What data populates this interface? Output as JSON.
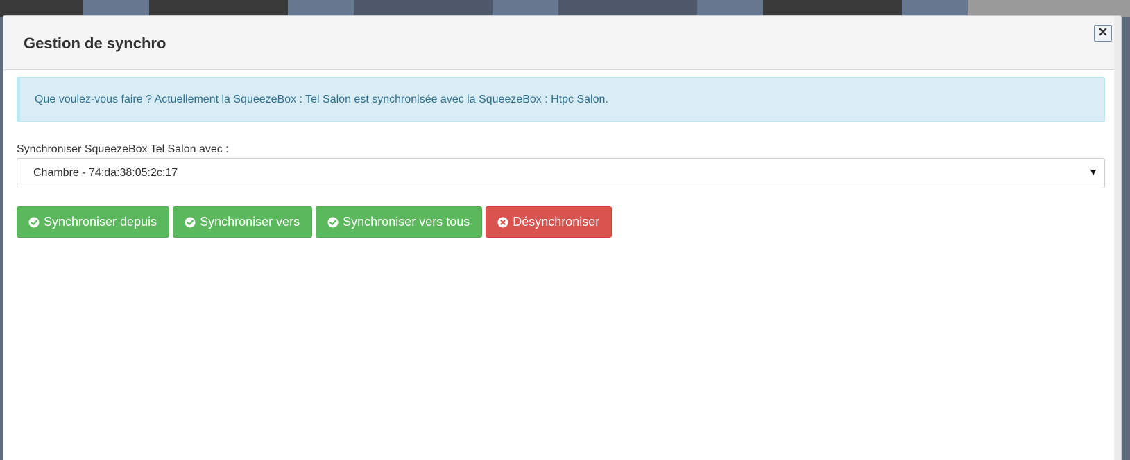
{
  "background": {
    "tile_colors": [
      "#3a3a3a",
      "#66788f",
      "#3a3a3a",
      "#66788f",
      "#4f5868",
      "#66788f",
      "#4f5868",
      "#66788f",
      "#3a3a3a",
      "#66788f",
      "#9a9a9a"
    ]
  },
  "modal": {
    "title": "Gestion de synchro",
    "close_icon": "close-icon"
  },
  "alert": {
    "text": "Que voulez-vous faire ? Actuellement la SqueezeBox : Tel Salon est synchronisée avec la SqueezeBox : Htpc Salon."
  },
  "form": {
    "label": "Synchroniser SqueezeBox Tel Salon avec :",
    "select_value": "Chambre - 74:da:38:05:2c:17",
    "caret": "▼"
  },
  "buttons": [
    {
      "label": "Synchroniser depuis",
      "icon": "check-circle-icon",
      "color": "#5cb85c"
    },
    {
      "label": "Synchroniser vers",
      "icon": "check-circle-icon",
      "color": "#5cb85c"
    },
    {
      "label": "Synchroniser vers tous",
      "icon": "check-circle-icon",
      "color": "#5cb85c"
    },
    {
      "label": "Désynchroniser",
      "icon": "times-circle-icon",
      "color": "#d9534f"
    }
  ]
}
